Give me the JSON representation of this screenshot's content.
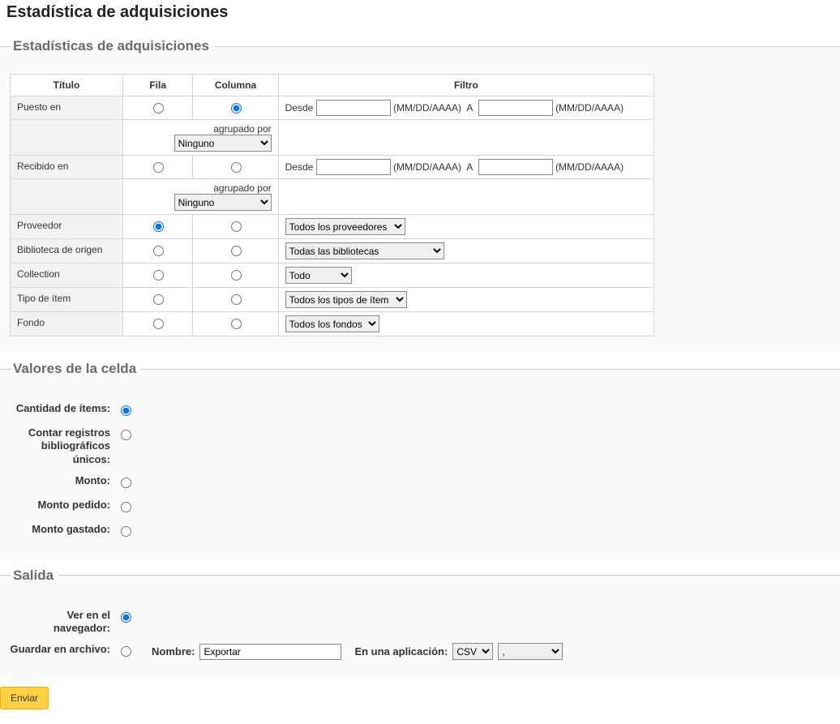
{
  "page_title": "Estadística de adquisiciones",
  "section_stats": {
    "legend": "Estadísticas de adquisiciones",
    "headers": {
      "title": "Título",
      "row": "Fila",
      "column": "Columna",
      "filter": "Filtro"
    },
    "date_filter": {
      "from_label": "Desde",
      "to_label": "A",
      "format_hint": "(MM/DD/AAAA)"
    },
    "grouped_by_label": "agrupado por",
    "grouped_by_selected": "Ninguno",
    "rows": {
      "placed_on": {
        "label": "Puesto en",
        "row_checked": false,
        "col_checked": true,
        "from": "",
        "to": ""
      },
      "received_on": {
        "label": "Recibido en",
        "row_checked": false,
        "col_checked": false,
        "from": "",
        "to": ""
      },
      "vendor": {
        "label": "Proveedor",
        "row_checked": true,
        "col_checked": false,
        "select_value": "Todos los proveedores"
      },
      "home_lib": {
        "label": "Biblioteca de origen",
        "row_checked": false,
        "col_checked": false,
        "select_value": "Todas las bibliotecas"
      },
      "collection": {
        "label": "Collection",
        "row_checked": false,
        "col_checked": false,
        "select_value": "Todo"
      },
      "item_type": {
        "label": "Tipo de ítem",
        "row_checked": false,
        "col_checked": false,
        "select_value": "Todos los tipos de ítem"
      },
      "fund": {
        "label": "Fondo",
        "row_checked": false,
        "col_checked": false,
        "select_value": "Todos los fondos"
      }
    }
  },
  "section_cell_values": {
    "legend": "Valores de la celda",
    "options": {
      "count_items": {
        "label": "Cantidad de ítems:",
        "checked": true
      },
      "count_biblios": {
        "label": "Contar registros bibliográficos únicos:",
        "checked": false
      },
      "amount": {
        "label": "Monto:",
        "checked": false
      },
      "amount_ordered": {
        "label": "Monto pedido:",
        "checked": false
      },
      "amount_spent": {
        "label": "Monto gastado:",
        "checked": false
      }
    }
  },
  "section_output": {
    "legend": "Salida",
    "options": {
      "browser": {
        "label": "Ver en el navegador:",
        "checked": true
      },
      "file": {
        "label": "Guardar en archivo:",
        "checked": false
      }
    },
    "file_controls": {
      "name_label": "Nombre:",
      "name_value": "Exportar",
      "app_label": "En una aplicación:",
      "format_value": "CSV",
      "separator_value": ","
    }
  },
  "submit_label": "Enviar"
}
